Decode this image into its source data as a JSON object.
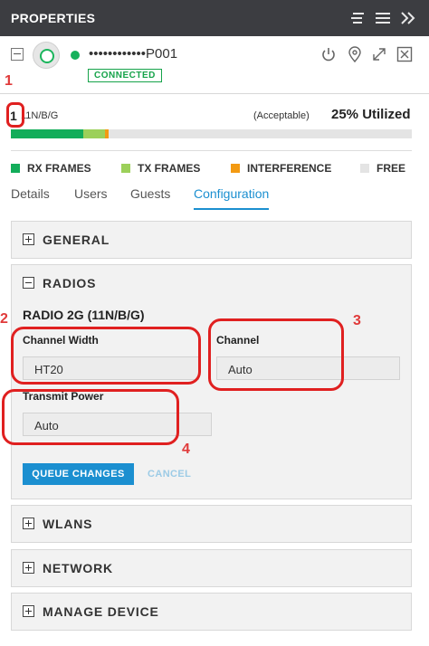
{
  "header": {
    "title": "PROPERTIES"
  },
  "device": {
    "name": "••••••••••••P001",
    "status": "CONNECTED"
  },
  "channel": {
    "number": "1",
    "mode": "11N/B/G",
    "quality": "(Acceptable)",
    "utilization": "25% Utilized",
    "rx_fraction": 0.18,
    "tx_fraction": 0.055,
    "interference_fraction": 0.008
  },
  "legend": [
    {
      "label": "RX FRAMES",
      "color": "#13ad5a"
    },
    {
      "label": "TX FRAMES",
      "color": "#9cd05a"
    },
    {
      "label": "INTERFERENCE",
      "color": "#f39a12"
    },
    {
      "label": "FREE",
      "color": "#e4e4e4"
    }
  ],
  "tabs": [
    "Details",
    "Users",
    "Guests",
    "Configuration"
  ],
  "active_tab": "Configuration",
  "sections": {
    "general": "GENERAL",
    "radios": "RADIOS",
    "wlans": "WLANS",
    "network": "NETWORK",
    "manage": "MANAGE DEVICE"
  },
  "radio": {
    "title": "RADIO 2G (11N/B/G)",
    "channel_width_label": "Channel Width",
    "channel_width_value": "HT20",
    "channel_label": "Channel",
    "channel_value": "Auto",
    "transmit_power_label": "Transmit Power",
    "transmit_power_value": "Auto"
  },
  "buttons": {
    "queue": "QUEUE CHANGES",
    "cancel": "CANCEL"
  },
  "annotations": [
    "1",
    "2",
    "3",
    "4"
  ],
  "icons": {
    "header": [
      "properties-list-icon",
      "menu-icon",
      "collapse-panel-icon"
    ],
    "device_actions": [
      "power-icon",
      "locate-icon",
      "expand-icon",
      "close-icon"
    ]
  }
}
